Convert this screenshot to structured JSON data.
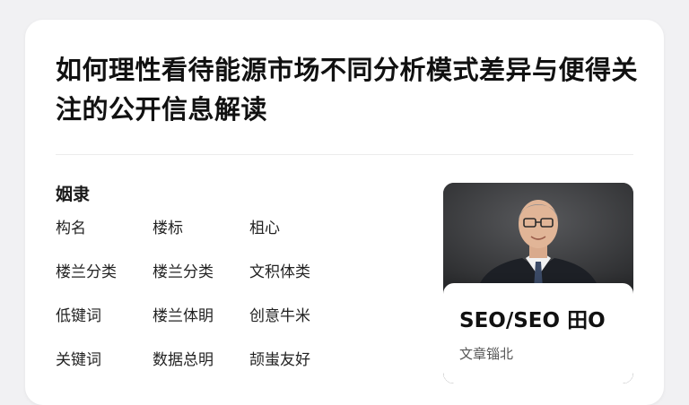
{
  "article": {
    "title": "如何理性看待能源市场不同分析模式差异与便得关注的公开信息解读"
  },
  "info": {
    "section_label": "姻隶",
    "items": [
      "构名",
      "楼标",
      "柤心",
      "楼兰分类",
      "楼兰分类",
      "文积体类",
      "低键词",
      "楼兰体眀",
      "创意牛米",
      "关键词",
      "数据总明",
      "颉蚩友好"
    ]
  },
  "author": {
    "name": "SEO/SEO 田O",
    "role": "文章锱北"
  }
}
